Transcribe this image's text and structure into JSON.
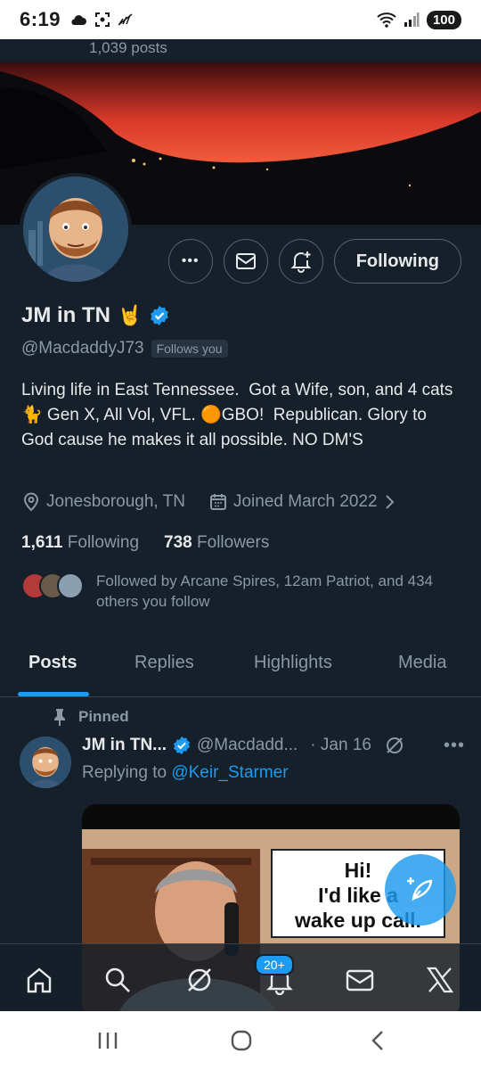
{
  "status_bar": {
    "time": "6:19",
    "battery": "100",
    "icons": [
      "cloud-icon",
      "screenshot-icon",
      "signal-off-icon",
      "wifi-icon",
      "cell-signal-icon"
    ]
  },
  "header": {
    "posts_count": "1,039 posts"
  },
  "profile": {
    "display_name": "JM in TN",
    "emoji": "🤘",
    "handle": "@MacdaddyJ73",
    "follows_you": "Follows you",
    "bio": "Living life in East Tennessee.  Got a Wife, son, and 4 cats 🐈 Gen X, All Vol, VFL. 🟠GBO!  Republican. Glory to God cause he makes it all possible. NO DM'S",
    "location": "Jonesborough, TN",
    "joined": "Joined March 2022",
    "following_count": "1,611",
    "following_label": "Following",
    "followers_count": "738",
    "followers_label": "Followers",
    "followed_by": "Followed by Arcane Spires, 12am Patriot, and 434 others you follow",
    "following_button": "Following",
    "more_button": "•••"
  },
  "tabs": [
    {
      "label": "Posts",
      "active": true
    },
    {
      "label": "Replies",
      "active": false
    },
    {
      "label": "Highlights",
      "active": false
    },
    {
      "label": "Media",
      "active": false
    }
  ],
  "pinned_post": {
    "pinned_label": "Pinned",
    "name": "JM in TN...",
    "handle": "@Macdadd...",
    "date": "· Jan 16",
    "replying_prefix": "Replying to",
    "replying_to": "@Keir_Starmer",
    "media_caption_line1": "Hi!",
    "media_caption_line2": "I'd like a",
    "media_caption_line3": "wake up call."
  },
  "bottom_nav": {
    "items": [
      "home-icon",
      "search-icon",
      "grok-icon",
      "notifications-icon",
      "messages-icon",
      "x-logo-icon"
    ],
    "notif_badge": "20+"
  },
  "colors": {
    "background": "#15202b",
    "accent": "#1d9bf0",
    "text_primary": "#e7e9ea",
    "text_secondary": "#8b98a5",
    "border": "#38444d"
  }
}
